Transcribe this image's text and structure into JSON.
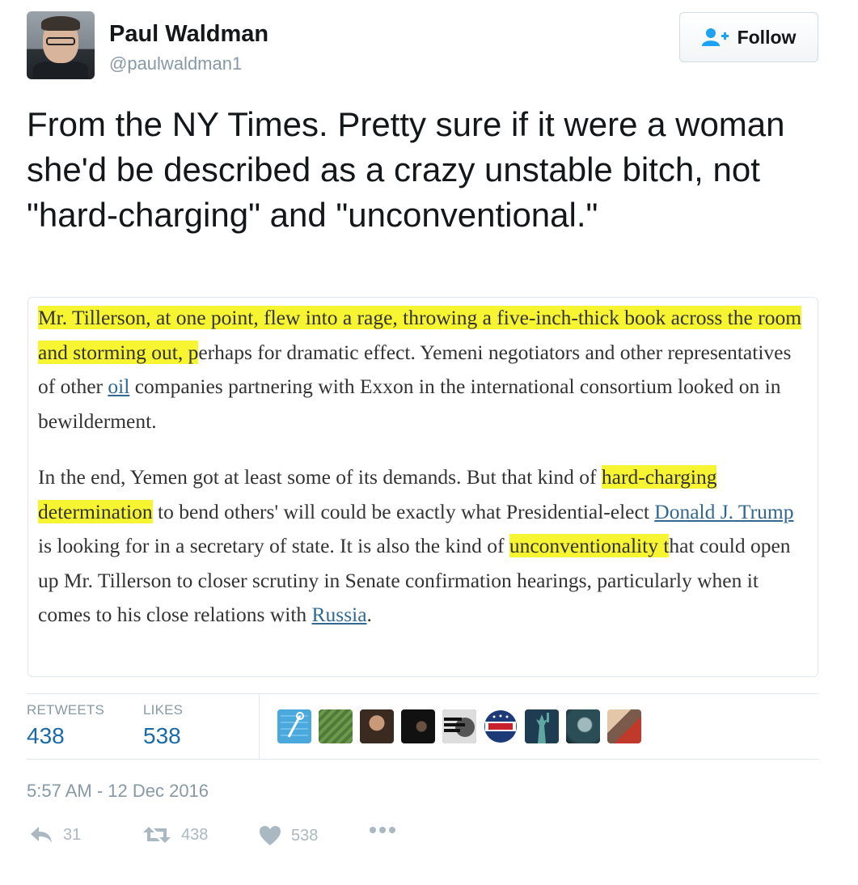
{
  "tweet": {
    "display_name": "Paul Waldman",
    "handle": "@paulwaldman1",
    "follow_label": "Follow",
    "text": "From the NY Times. Pretty sure if it were a woman she'd be described as a crazy unstable bitch, not \"hard-charging\" and \"unconventional.\"",
    "timestamp": "5:57 AM - 12 Dec 2016"
  },
  "article": {
    "p1_hl": "Mr. Tillerson, at one point, flew into a rage, throwing a five-inch-thick book across the room and storming out, p",
    "p1_a": "erhaps for dramatic effect. Yemeni negotiators and other representatives of other ",
    "p1_link": "oil",
    "p1_b": " companies partnering with Exxon in the international consortium looked on in bewilderment.",
    "p2_a": "In the end, Yemen got at least some of its demands. But that kind of ",
    "p2_hl1": "hard-charging determination",
    "p2_b": " to bend others' will could be exactly what Presidential-elect ",
    "p2_link1": "Donald J. Trump",
    "p2_c": " is looking for in a secretary of state. It is also the kind of ",
    "p2_hl2": "unconventionality t",
    "p2_d": "hat could open up Mr. Tillerson to closer scrutiny in Senate confirmation hearings, particularly when it comes to his close relations with ",
    "p2_link2": "Russia",
    "p2_e": "."
  },
  "stats": {
    "retweets_label": "RETWEETS",
    "retweets_value": "438",
    "likes_label": "LIKES",
    "likes_value": "538"
  },
  "likers": [
    {
      "name": "liker-avatar-pin",
      "color": "#4aa8dc"
    },
    {
      "name": "liker-avatar-green",
      "color": "#4f7a3a"
    },
    {
      "name": "liker-avatar-woman",
      "color": "#6b4a33"
    },
    {
      "name": "liker-avatar-dark",
      "color": "#151515"
    },
    {
      "name": "liker-avatar-not-my-president",
      "color": "#2b2b2b",
      "text": "NOT MY PRESIDENT"
    },
    {
      "name": "liker-avatar-vote",
      "color": "#ffffff",
      "text": "VOTE"
    },
    {
      "name": "liker-avatar-statue-liberty",
      "color": "#1f3d52"
    },
    {
      "name": "liker-avatar-teal",
      "color": "#2b4d55"
    },
    {
      "name": "liker-avatar-couple",
      "color": "#7a5a4a"
    }
  ],
  "actions": {
    "reply_count": "31",
    "retweet_count": "438",
    "like_count": "538"
  },
  "colors": {
    "link_blue": "#1b6aa5",
    "highlight_yellow": "#f7f432",
    "muted_gray": "#8899a6"
  }
}
